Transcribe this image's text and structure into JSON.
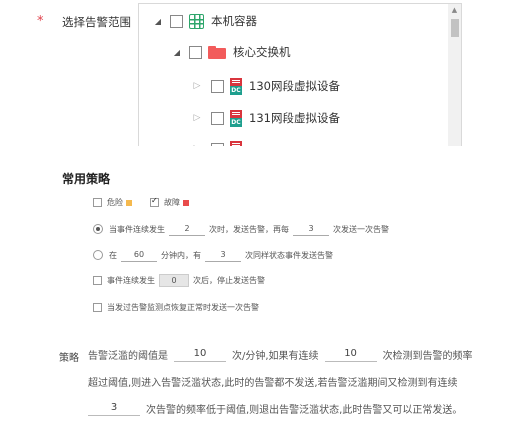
{
  "scope": {
    "required_mark": "*",
    "label": "选择告警范围",
    "tree": {
      "root": {
        "label": "本机容器"
      },
      "group": {
        "label": "核心交换机"
      },
      "devices": [
        {
          "label": "130网段虚拟设备"
        },
        {
          "label": "131网段虚拟设备"
        }
      ]
    }
  },
  "strategy": {
    "title": "常用策略",
    "levels": [
      {
        "label": "危险",
        "checked": false,
        "color": "#f5b94e"
      },
      {
        "label": "故障",
        "checked": true,
        "color": "#e94b4b"
      }
    ],
    "rule1": {
      "pre": "当事件连续发生",
      "count": "2",
      "mid": "次时，发送告警，再每",
      "every": "3",
      "post": "次发送一次告警"
    },
    "rule2": {
      "pre": "在",
      "minutes": "60",
      "mid": "分钟内，有",
      "count": "3",
      "post": "次同样状态事件发送告警"
    },
    "rule3": {
      "pre": "事件连续发生",
      "count": "0",
      "post": "次后，停止发送告警"
    },
    "rule4": {
      "label": "当发过告警监测点恢复正常时发送一次告警"
    }
  },
  "policy": {
    "label": "策略",
    "line1_a": "告警泛滥的阈值是",
    "threshold": "10",
    "line1_b": "次/分钟,如果有连续",
    "consecutive": "10",
    "line1_c": "次检测到告警的频率",
    "line2": "超过阈值,则进入告警泛滥状态,此时的告警都不发送,若告警泛滥期间又检测到有连续",
    "recover": "3",
    "line3": "次告警的频率低于阈值,则退出告警泛滥状态,此时告警又可以正常发送。"
  }
}
